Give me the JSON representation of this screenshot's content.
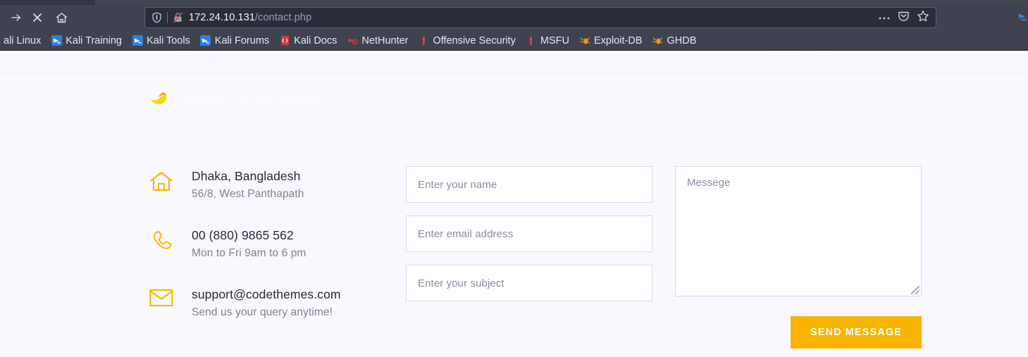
{
  "browser": {
    "toolbar": {
      "forward_icon": "forward-arrow-icon",
      "stop_icon": "stop-x-icon",
      "home_icon": "home-icon",
      "shield_icon": "shield-icon",
      "insecure_icon": "broken-padlock-icon",
      "more_icon": "ellipsis-icon",
      "pocket_icon": "pocket-icon",
      "bookmark_icon": "star-icon"
    },
    "url": {
      "host": "172.24.10.131",
      "path": "/contact.php"
    },
    "bookmarks": [
      {
        "label": "ali Linux",
        "icon": "kali-dragon-icon",
        "icon_color": "#367bf0"
      },
      {
        "label": "Kali Training",
        "icon": "kali-dragon-icon",
        "icon_color": "#367bf0"
      },
      {
        "label": "Kali Tools",
        "icon": "kali-dragon-icon",
        "icon_color": "#367bf0"
      },
      {
        "label": "Kali Forums",
        "icon": "kali-dragon-icon",
        "icon_color": "#367bf0"
      },
      {
        "label": "Kali Docs",
        "icon": "kali-docs-icon",
        "icon_color": "#d33a3a"
      },
      {
        "label": "NetHunter",
        "icon": "nethunter-icon",
        "icon_color": "#d33a3a"
      },
      {
        "label": "Offensive Security",
        "icon": "offsec-icon",
        "icon_color": "#e04a4a"
      },
      {
        "label": "MSFU",
        "icon": "metasploit-icon",
        "icon_color": "#e04a4a"
      },
      {
        "label": "Exploit-DB",
        "icon": "exploitdb-icon",
        "icon_color": "#e8952e"
      },
      {
        "label": "GHDB",
        "icon": "ghdb-icon",
        "icon_color": "#e8952e"
      }
    ]
  },
  "site": {
    "topbar": {
      "social": [
        {
          "name": "facebook-icon",
          "glyph": "f"
        },
        {
          "name": "twitter-icon",
          "glyph": "t"
        },
        {
          "name": "dribbble-icon",
          "glyph": "d"
        },
        {
          "name": "behance-icon",
          "glyph": "Be"
        }
      ],
      "phone": "+880 012 3654 896",
      "account": "Register / Login"
    },
    "brand": {
      "name": "Security Services",
      "logo_icon": "circle-logo-icon"
    },
    "nav": [
      {
        "label": "HOME"
      },
      {
        "label": "ABOUT US"
      },
      {
        "label": "SERVICE"
      },
      {
        "label": "TEAM"
      },
      {
        "label": "BLOG"
      },
      {
        "label": "CONTACT"
      }
    ],
    "accent_color": "#f7b500",
    "page_background": "#f8f8fe"
  },
  "contact": {
    "info": [
      {
        "icon": "home-outline-icon",
        "title": "Dhaka, Bangladesh",
        "subtitle": "56/8, West Panthapath"
      },
      {
        "icon": "phone-outline-icon",
        "title": "00 (880) 9865 562",
        "subtitle": "Mon to Fri 9am to 6 pm"
      },
      {
        "icon": "envelope-outline-icon",
        "title": "support@codethemes.com",
        "subtitle": "Send us your query anytime!"
      }
    ],
    "form": {
      "name_placeholder": "Enter your name",
      "email_placeholder": "Enter email address",
      "subject_placeholder": "Enter your subject",
      "message_placeholder": "Messege",
      "submit_label": "SEND MESSAGE"
    }
  }
}
